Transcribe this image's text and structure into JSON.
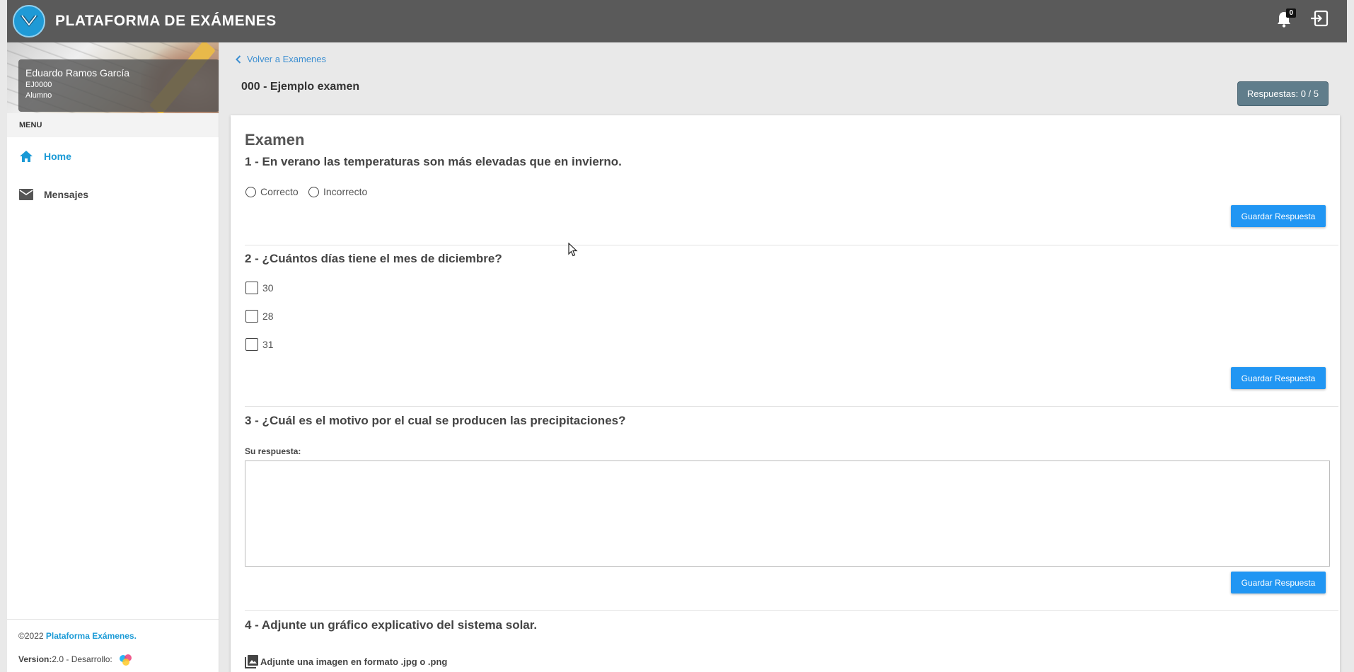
{
  "app": {
    "title": "PLATAFORMA DE EXÁMENES",
    "notifications_count": "0"
  },
  "user": {
    "name": "Eduardo Ramos García",
    "id": "EJ0000",
    "role": "Alumno"
  },
  "menu": {
    "label": "MENU",
    "items": [
      {
        "label": "Home",
        "icon": "home-icon",
        "active": true
      },
      {
        "label": "Mensajes",
        "icon": "mail-icon",
        "active": false
      }
    ]
  },
  "footer": {
    "copyright": "©2022 ",
    "brand": "Plataforma Exámenes.",
    "version_label": "Version:",
    "version_value": " 2.0 - Desarrollo:"
  },
  "header": {
    "back_label": "Volver a Examenes",
    "exam_title": "000 - Ejemplo examen",
    "responses_badge": "Respuestas: 0 / 5"
  },
  "exam": {
    "section_title": "Examen",
    "save_label": "Guardar Respuesta",
    "questions": [
      {
        "text": "1 - En verano las temperaturas son más elevadas que en invierno.",
        "type": "radio",
        "options": [
          "Correcto",
          "Incorrecto"
        ]
      },
      {
        "text": "2 - ¿Cuántos días tiene el mes de diciembre?",
        "type": "checkbox",
        "options": [
          "30",
          "28",
          "31"
        ]
      },
      {
        "text": "3 - ¿Cuál es el motivo por el cual se producen las precipitaciones?",
        "type": "text",
        "answer_label": "Su respuesta:",
        "answer_value": ""
      },
      {
        "text": "4 - Adjunte un gráfico explicativo del sistema solar.",
        "type": "file",
        "attach_label": "Adjunte una imagen en formato .jpg o .png"
      }
    ]
  },
  "colors": {
    "accent": "#2196f3",
    "topbar": "#5a5a5a",
    "badge": "#607d8b",
    "link": "#1a9ad6"
  }
}
